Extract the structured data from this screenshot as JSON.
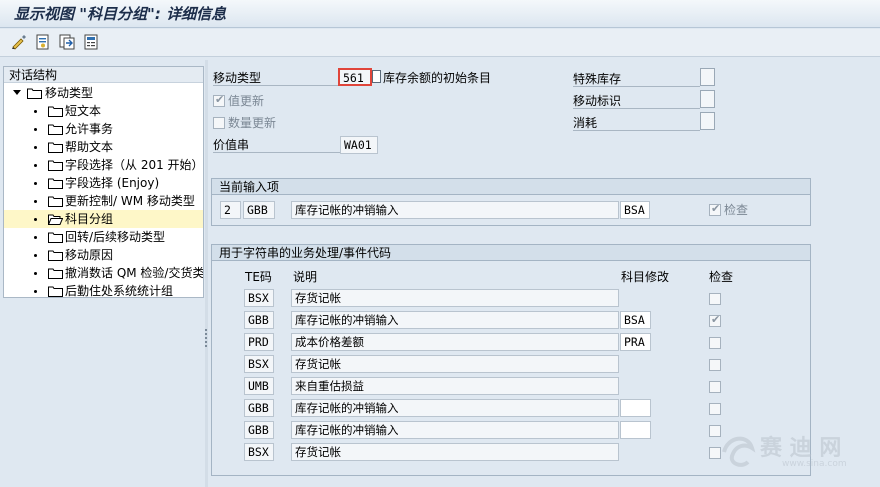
{
  "window": {
    "title": "显示视图 \"科目分组\": 详细信息"
  },
  "toolbar": {
    "icons": [
      "edit-icon",
      "display-icon",
      "copy-icon",
      "info-icon"
    ]
  },
  "tree": {
    "header": "对话结构",
    "root": "移动类型",
    "items": [
      {
        "label": "短文本"
      },
      {
        "label": "允许事务"
      },
      {
        "label": "帮助文本"
      },
      {
        "label": "字段选择（从 201 开始）/"
      },
      {
        "label": "字段选择 (Enjoy)"
      },
      {
        "label": "更新控制/ WM 移动类型"
      },
      {
        "label": "科目分组",
        "selected": true,
        "open": true
      },
      {
        "label": "回转/后续移动类型"
      },
      {
        "label": "移动原因"
      },
      {
        "label": "撤消数话 QM 检验/交货类"
      },
      {
        "label": "后勤住处系统统计组"
      }
    ]
  },
  "header_fields": {
    "movement_type_label": "移动类型",
    "movement_type_value": "561",
    "movement_type_desc": "库存余额的初始条目",
    "value_update_label": "值更新",
    "value_update_checked": true,
    "qty_update_label": "数量更新",
    "qty_update_checked": false,
    "value_string_label": "价值串",
    "value_string_value": "WA01",
    "special_stock_label": "特殊库存",
    "movement_ind_label": "移动标识",
    "consumption_label": "消耗"
  },
  "current_entry": {
    "title": "当前输入项",
    "counter": "2",
    "te_code": "GBB",
    "description": "库存记帐的冲销输入",
    "acct_modifier": "BSA",
    "check_label": "检查",
    "check_checked": true
  },
  "process_table": {
    "title": "用于字符串的业务处理/事件代码",
    "columns": {
      "te": "TE码",
      "desc": "说明",
      "acct": "科目修改",
      "check": "检查"
    },
    "rows": [
      {
        "te": "BSX",
        "desc": "存货记帐",
        "acct": null,
        "check": false
      },
      {
        "te": "GBB",
        "desc": "库存记帐的冲销输入",
        "acct": "BSA",
        "check": true
      },
      {
        "te": "PRD",
        "desc": "成本价格差额",
        "acct": "PRA",
        "check": false
      },
      {
        "te": "BSX",
        "desc": "存货记帐",
        "acct": null,
        "check": false
      },
      {
        "te": "UMB",
        "desc": "来自重估损益",
        "acct": null,
        "check": false
      },
      {
        "te": "GBB",
        "desc": "库存记帐的冲销输入",
        "acct": "",
        "check": false
      },
      {
        "te": "GBB",
        "desc": "库存记帐的冲销输入",
        "acct": "",
        "check": false
      },
      {
        "te": "BSX",
        "desc": "存货记帐",
        "acct": null,
        "check": false
      }
    ]
  },
  "watermark": {
    "text": "赛 迪 网",
    "url": "www.sina.com"
  }
}
